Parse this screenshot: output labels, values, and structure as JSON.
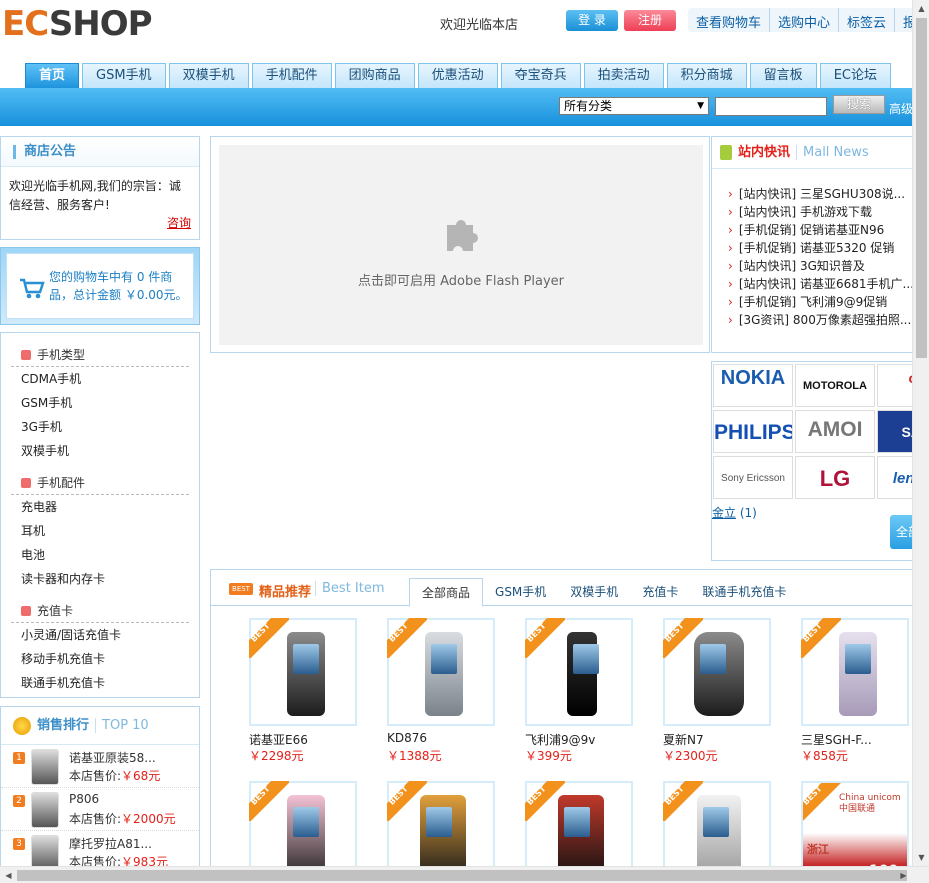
{
  "header": {
    "logo_ec": "EC",
    "logo_shop": "SHOP",
    "welcome": "欢迎光临本店",
    "login": "登 录",
    "register": "注册",
    "links": [
      "查看购物车",
      "选购中心",
      "标签云",
      "报价单"
    ]
  },
  "nav": {
    "tabs": [
      "首页",
      "GSM手机",
      "双模手机",
      "手机配件",
      "团购商品",
      "优惠活动",
      "夺宝奇兵",
      "拍卖活动",
      "积分商城",
      "留言板",
      "EC论坛"
    ]
  },
  "search": {
    "category": "所有分类",
    "keyword": "",
    "button": "搜索",
    "advanced": "高级搜索"
  },
  "notice": {
    "title": "商店公告",
    "text": "欢迎光临手机网,我们的宗旨：诚信经营、服务客户!",
    "more": "咨询"
  },
  "cart": {
    "text": "您的购物车中有 0 件商品，总计金额 ￥0.00元。"
  },
  "categories": [
    {
      "title": "手机类型",
      "items": [
        "CDMA手机",
        "GSM手机",
        "3G手机",
        "双模手机"
      ]
    },
    {
      "title": "手机配件",
      "items": [
        "充电器",
        "耳机",
        "电池",
        "读卡器和内存卡"
      ]
    },
    {
      "title": "充值卡",
      "items": [
        "小灵通/固话充值卡",
        "移动手机充值卡",
        "联通手机充值卡"
      ]
    }
  ],
  "top10": {
    "title": "销售排行",
    "title_en": "TOP 10",
    "items": [
      {
        "rank": "1",
        "name": "诺基亚原装58...",
        "price_label": "本店售价:",
        "price": "￥68元"
      },
      {
        "rank": "2",
        "name": "P806",
        "price_label": "本店售价:",
        "price": "￥2000元"
      },
      {
        "rank": "3",
        "name": "摩托罗拉A81...",
        "price_label": "本店售价:",
        "price": "￥983元"
      }
    ]
  },
  "flash": {
    "text": "点击即可启用 Adobe Flash Player"
  },
  "news": {
    "title": "站内快讯",
    "title_en": "Mall News",
    "items": [
      "[站内快讯] 三星SGHU308说...",
      "[站内快讯] 手机游戏下载",
      "[手机促销] 促销诺基亚N96",
      "[手机促销] 诺基亚5320 促销",
      "[站内快讯] 3G知识普及",
      "[站内快讯] 诺基亚6681手机广...",
      "[手机促销] 飞利浦9@9促销",
      "[3G资讯] 800万像素超强拍照..."
    ]
  },
  "brands": {
    "names": [
      "NOKIA",
      "MOTOROLA",
      "oo",
      "PHILIPS",
      "AMOI",
      "SAM",
      "Sony Ericsson",
      "LG",
      "lenovo"
    ],
    "golden_link": "金立",
    "golden_count": "(1)",
    "all_button": "全部"
  },
  "best": {
    "badge": "BEST",
    "title": "精品推荐",
    "title_en": "Best Item",
    "tabs": [
      "全部商品",
      "GSM手机",
      "双模手机",
      "充值卡",
      "联通手机充值卡"
    ],
    "ribbon": "BEST",
    "products": [
      {
        "name": "诺基亚E66",
        "price": "￥2298元"
      },
      {
        "name": "KD876",
        "price": "￥1388元"
      },
      {
        "name": "飞利浦9@9v",
        "price": "￥399元"
      },
      {
        "name": "夏新N7",
        "price": "￥2300元"
      },
      {
        "name": "三星SGH-F...",
        "price": "￥858元"
      },
      {
        "name": "",
        "price": ""
      },
      {
        "name": "",
        "price": ""
      },
      {
        "name": "",
        "price": ""
      },
      {
        "name": "",
        "price": ""
      },
      {
        "name": "",
        "price": ""
      }
    ],
    "card_logo_text": "China unicom中国联通",
    "card_region": "浙江",
    "card_value": "100"
  },
  "colors": {
    "brand_orange": "#e2701c",
    "nav_blue": "#1d93dd",
    "price_red": "#e3211a",
    "link_blue": "#0b5fa4"
  }
}
